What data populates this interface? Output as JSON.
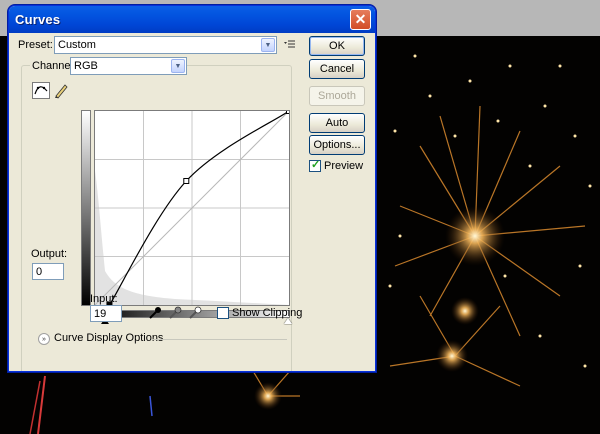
{
  "window": {
    "title": "Curves"
  },
  "preset": {
    "label": "Preset:",
    "value": "Custom"
  },
  "channel": {
    "label": "Channel:",
    "value": "RGB"
  },
  "buttons": {
    "ok": "OK",
    "cancel": "Cancel",
    "smooth": "Smooth",
    "auto": "Auto",
    "options": "Options..."
  },
  "preview": {
    "label": "Preview",
    "checked": true
  },
  "output": {
    "label": "Output:",
    "value": "0"
  },
  "input": {
    "label": "Input:",
    "value": "19"
  },
  "show_clipping": {
    "label": "Show Clipping",
    "checked": false
  },
  "display_options": {
    "label": "Curve Display Options"
  },
  "curve": {
    "points": [
      [
        19,
        0
      ],
      [
        120,
        163
      ],
      [
        255,
        255
      ]
    ]
  },
  "icons": [
    "close-icon",
    "curve-edit-icon",
    "pencil-icon",
    "preset-menu-icon",
    "black-eyedropper-icon",
    "gray-eyedropper-icon",
    "white-eyedropper-icon",
    "expand-chevron-icon"
  ]
}
